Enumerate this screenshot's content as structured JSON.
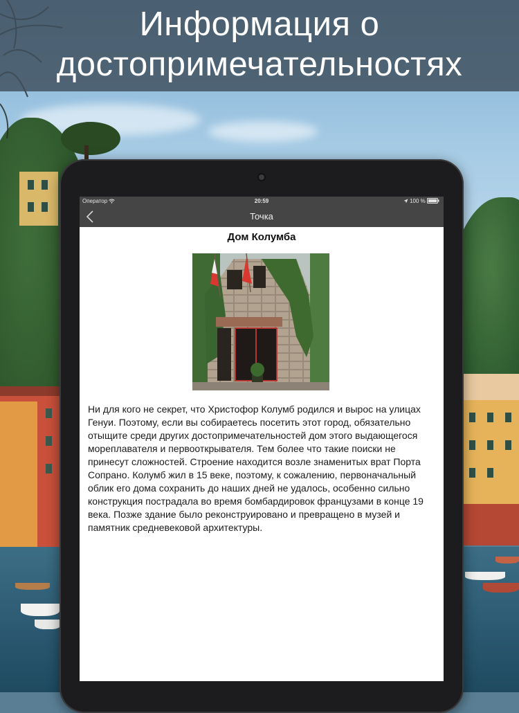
{
  "banner": {
    "headline_line1": "Информация о",
    "headline_line2": "достопримечательностях"
  },
  "device": {
    "status_bar": {
      "carrier": "Оператор",
      "time": "20:59",
      "battery": "100 %"
    },
    "nav_bar": {
      "title": "Точка",
      "back_icon": "chevron-left-icon"
    },
    "content": {
      "place_title": "Дом Колумба",
      "description": "Ни для кого не секрет, что Христофор Колумб родился и вырос на улицах Генуи. Поэтому, если вы собираетесь посетить этот город, обязательно отыщите среди других достопримечательностей дом этого выдающегося мореплавателя и первооткрывателя. Тем более что такие поиски не принесут сложностей. Строение находится возле знаменитых врат Порта Сопрано. Колумб жил в 15 веке, поэтому, к сожалению, первоначальный облик его дома сохранить до наших дней не удалось, особенно сильно конструкция пострадала во время бомбардировок французами в конце 19 века. Позже здание было реконструировано и превращено в музей и памятник средневековой архитектуры."
    }
  },
  "colors": {
    "header_band": "#3e4e5c",
    "nav_bar": "#454545",
    "tablet_frame": "#1c1c1e"
  }
}
